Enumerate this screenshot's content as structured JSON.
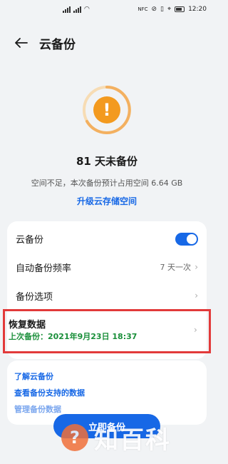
{
  "status_bar": {
    "left_badge": "NFC",
    "time": "12:20"
  },
  "header": {
    "title": "云备份"
  },
  "status": {
    "days_label": "81 天未备份",
    "space_text": "空间不足，本次备份预计占用空间 6.64 GB",
    "upgrade_link": "升级云存储空间",
    "warning_symbol": "!"
  },
  "settings": {
    "cloud_backup": {
      "label": "云备份",
      "enabled": true
    },
    "auto_frequency": {
      "label": "自动备份频率",
      "value": "7 天一次"
    },
    "backup_options": {
      "label": "备份选项"
    },
    "restore": {
      "label": "恢复数据",
      "last_backup": "上次备份：2021年9月23日 18:37"
    }
  },
  "links": {
    "learn": "了解云备份",
    "supported": "查看备份支持的数据",
    "partial": "管理备份数据"
  },
  "primary_button": "立即备份",
  "watermark": {
    "symbol": "?",
    "text": "知百科"
  },
  "colors": {
    "accent": "#1768e6",
    "warning": "#f39a1f",
    "highlight_border": "#e23a3a",
    "success_text": "#1a8f3a"
  }
}
